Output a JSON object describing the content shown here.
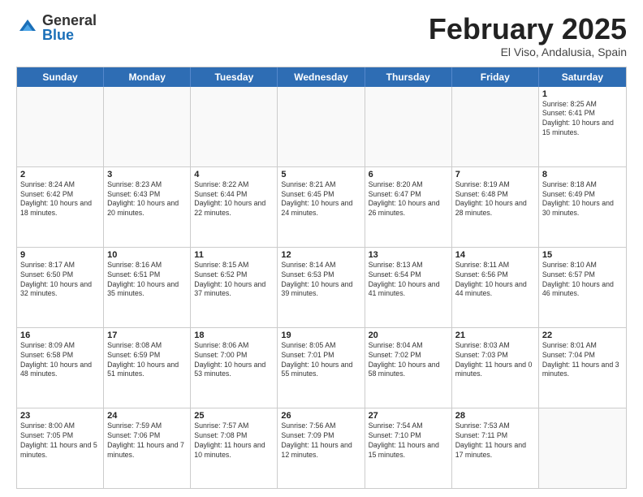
{
  "logo": {
    "general": "General",
    "blue": "Blue"
  },
  "title": "February 2025",
  "location": "El Viso, Andalusia, Spain",
  "header_days": [
    "Sunday",
    "Monday",
    "Tuesday",
    "Wednesday",
    "Thursday",
    "Friday",
    "Saturday"
  ],
  "weeks": [
    [
      {
        "day": "",
        "info": ""
      },
      {
        "day": "",
        "info": ""
      },
      {
        "day": "",
        "info": ""
      },
      {
        "day": "",
        "info": ""
      },
      {
        "day": "",
        "info": ""
      },
      {
        "day": "",
        "info": ""
      },
      {
        "day": "1",
        "info": "Sunrise: 8:25 AM\nSunset: 6:41 PM\nDaylight: 10 hours and 15 minutes."
      }
    ],
    [
      {
        "day": "2",
        "info": "Sunrise: 8:24 AM\nSunset: 6:42 PM\nDaylight: 10 hours and 18 minutes."
      },
      {
        "day": "3",
        "info": "Sunrise: 8:23 AM\nSunset: 6:43 PM\nDaylight: 10 hours and 20 minutes."
      },
      {
        "day": "4",
        "info": "Sunrise: 8:22 AM\nSunset: 6:44 PM\nDaylight: 10 hours and 22 minutes."
      },
      {
        "day": "5",
        "info": "Sunrise: 8:21 AM\nSunset: 6:45 PM\nDaylight: 10 hours and 24 minutes."
      },
      {
        "day": "6",
        "info": "Sunrise: 8:20 AM\nSunset: 6:47 PM\nDaylight: 10 hours and 26 minutes."
      },
      {
        "day": "7",
        "info": "Sunrise: 8:19 AM\nSunset: 6:48 PM\nDaylight: 10 hours and 28 minutes."
      },
      {
        "day": "8",
        "info": "Sunrise: 8:18 AM\nSunset: 6:49 PM\nDaylight: 10 hours and 30 minutes."
      }
    ],
    [
      {
        "day": "9",
        "info": "Sunrise: 8:17 AM\nSunset: 6:50 PM\nDaylight: 10 hours and 32 minutes."
      },
      {
        "day": "10",
        "info": "Sunrise: 8:16 AM\nSunset: 6:51 PM\nDaylight: 10 hours and 35 minutes."
      },
      {
        "day": "11",
        "info": "Sunrise: 8:15 AM\nSunset: 6:52 PM\nDaylight: 10 hours and 37 minutes."
      },
      {
        "day": "12",
        "info": "Sunrise: 8:14 AM\nSunset: 6:53 PM\nDaylight: 10 hours and 39 minutes."
      },
      {
        "day": "13",
        "info": "Sunrise: 8:13 AM\nSunset: 6:54 PM\nDaylight: 10 hours and 41 minutes."
      },
      {
        "day": "14",
        "info": "Sunrise: 8:11 AM\nSunset: 6:56 PM\nDaylight: 10 hours and 44 minutes."
      },
      {
        "day": "15",
        "info": "Sunrise: 8:10 AM\nSunset: 6:57 PM\nDaylight: 10 hours and 46 minutes."
      }
    ],
    [
      {
        "day": "16",
        "info": "Sunrise: 8:09 AM\nSunset: 6:58 PM\nDaylight: 10 hours and 48 minutes."
      },
      {
        "day": "17",
        "info": "Sunrise: 8:08 AM\nSunset: 6:59 PM\nDaylight: 10 hours and 51 minutes."
      },
      {
        "day": "18",
        "info": "Sunrise: 8:06 AM\nSunset: 7:00 PM\nDaylight: 10 hours and 53 minutes."
      },
      {
        "day": "19",
        "info": "Sunrise: 8:05 AM\nSunset: 7:01 PM\nDaylight: 10 hours and 55 minutes."
      },
      {
        "day": "20",
        "info": "Sunrise: 8:04 AM\nSunset: 7:02 PM\nDaylight: 10 hours and 58 minutes."
      },
      {
        "day": "21",
        "info": "Sunrise: 8:03 AM\nSunset: 7:03 PM\nDaylight: 11 hours and 0 minutes."
      },
      {
        "day": "22",
        "info": "Sunrise: 8:01 AM\nSunset: 7:04 PM\nDaylight: 11 hours and 3 minutes."
      }
    ],
    [
      {
        "day": "23",
        "info": "Sunrise: 8:00 AM\nSunset: 7:05 PM\nDaylight: 11 hours and 5 minutes."
      },
      {
        "day": "24",
        "info": "Sunrise: 7:59 AM\nSunset: 7:06 PM\nDaylight: 11 hours and 7 minutes."
      },
      {
        "day": "25",
        "info": "Sunrise: 7:57 AM\nSunset: 7:08 PM\nDaylight: 11 hours and 10 minutes."
      },
      {
        "day": "26",
        "info": "Sunrise: 7:56 AM\nSunset: 7:09 PM\nDaylight: 11 hours and 12 minutes."
      },
      {
        "day": "27",
        "info": "Sunrise: 7:54 AM\nSunset: 7:10 PM\nDaylight: 11 hours and 15 minutes."
      },
      {
        "day": "28",
        "info": "Sunrise: 7:53 AM\nSunset: 7:11 PM\nDaylight: 11 hours and 17 minutes."
      },
      {
        "day": "",
        "info": ""
      }
    ]
  ]
}
